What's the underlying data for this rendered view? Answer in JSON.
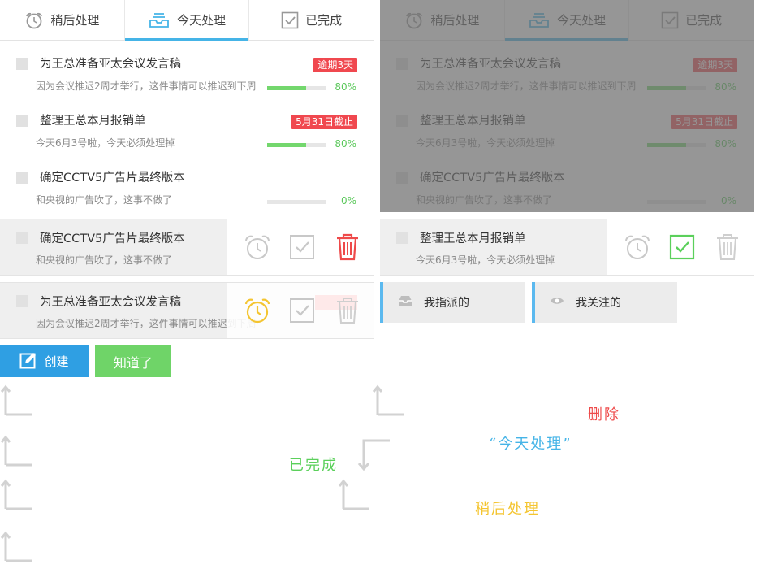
{
  "tabs": {
    "later": "稍后处理",
    "today": "今天处理",
    "done": "已完成"
  },
  "tasks": [
    {
      "title": "为王总准备亚太会议发言稿",
      "desc": "因为会议推迟2周才举行，这件事情可以推迟到下周",
      "badge": "逾期3天",
      "progress": 0.67,
      "progress_text": "80%"
    },
    {
      "title": "整理王总本月报销单",
      "desc": "今天6月3号啦，今天必须处理掉",
      "badge": "5月31日截止",
      "progress": 0.67,
      "progress_text": "80%"
    },
    {
      "title": "确定CCTV5广告片最终版本",
      "desc": "和央视的广告吹了，这事不做了",
      "badge": "",
      "progress": 0,
      "progress_text": "0%"
    }
  ],
  "swipe_left": [
    {
      "title": "确定CCTV5广告片最终版本",
      "desc": "和央视的广告吹了，这事不做了",
      "highlight": "delete"
    },
    {
      "title": "为王总准备亚太会议发言稿",
      "desc": "因为会议推迟2周才举行，这件事情可以推迟到下周",
      "highlight": "later"
    }
  ],
  "swipe_right": {
    "title": "整理王总本月报销单",
    "desc": "今天6月3号啦，今天必须处理掉",
    "highlight": "done"
  },
  "buttons": {
    "create": "创建",
    "got_it": "知道了"
  },
  "filters": {
    "assigned": "我指派的",
    "following": "我关注的"
  },
  "notes": {
    "done": "已完成",
    "delete": "删除",
    "today": "“今天处理”",
    "later": "稍后处理"
  },
  "colors": {
    "accent": "#45b4e7",
    "badge": "#f0484f",
    "progress": "#73d76d",
    "done_green": "#5bd05b",
    "delete_red": "#ee4a4a",
    "later_yellow": "#f4c531",
    "create_blue": "#2f9fe3",
    "gotit_green": "#6fd468"
  },
  "icons": {
    "later": "alarm-clock-icon",
    "today": "inbox-tray-icon",
    "done": "checkbox-icon",
    "delete": "trash-icon",
    "create": "edit-icon",
    "assigned": "inbox-icon",
    "following": "eye-icon"
  }
}
